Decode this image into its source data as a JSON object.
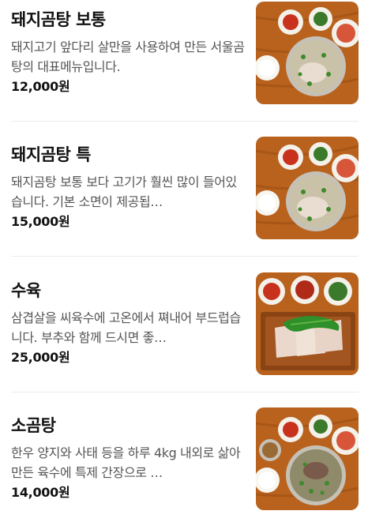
{
  "menu": {
    "currency_colors": {
      "wood": "#b8621d",
      "broth": "#c9c2a8",
      "metal": "#c6c1b6"
    },
    "items": [
      {
        "name": "돼지곰탕 보통",
        "description": "돼지고기 앞다리 살만을 사용하여 만든 서울곰탕의 대표메뉴입니다.",
        "price": "12,000원",
        "photo_icon": "pork-soup-photo"
      },
      {
        "name": "돼지곰탕 특",
        "description": "돼지곰탕 보통 보다 고기가 훨씬 많이 들어있습니다. 기본 소면이 제공됩…",
        "price": "15,000원",
        "photo_icon": "pork-soup-large-photo"
      },
      {
        "name": "수육",
        "description": "삼겹살을 씨육수에 고온에서 쪄내어 부드럽습니다. 부추와 함께 드시면 좋…",
        "price": "25,000원",
        "photo_icon": "boiled-pork-photo"
      },
      {
        "name": "소곰탕",
        "description": "한우 양지와 사태 등을 하루 4kg 내외로 삶아 만든 육수에 특제 간장으로 …",
        "price": "14,000원",
        "photo_icon": "beef-soup-photo"
      }
    ]
  }
}
